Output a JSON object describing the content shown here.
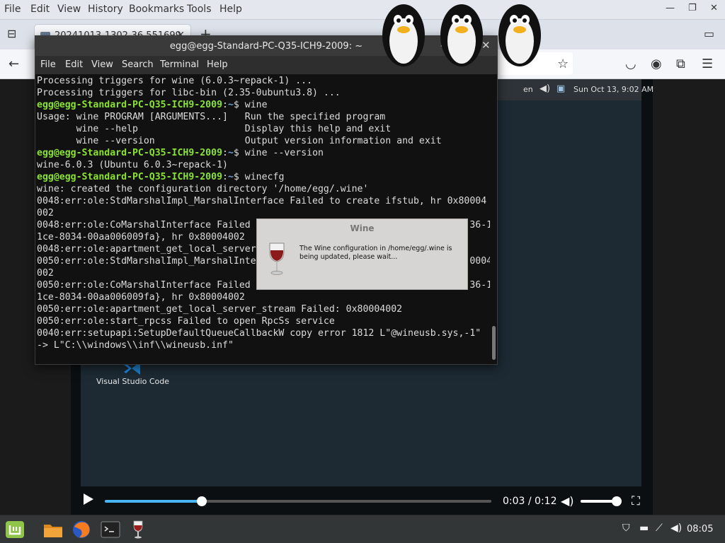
{
  "firefox": {
    "menu": [
      "File",
      "Edit",
      "View",
      "History",
      "Bookmarks",
      "Tools",
      "Help"
    ],
    "tab_title": "20241013-1302-36.551699",
    "new_tab": "+",
    "window_buttons": [
      "—",
      "❐",
      "✕"
    ]
  },
  "vm_panel": {
    "language": "en",
    "datetime": "Sun Oct 13,  9:02 AM"
  },
  "desktop": {
    "icon_label": "Visual Studio Code"
  },
  "terminal": {
    "title": "egg@egg-Standard-PC-Q35-ICH9-2009: ~",
    "menu": [
      "File",
      "Edit",
      "View",
      "Search",
      "Terminal",
      "Help"
    ],
    "lines": [
      {
        "text": "Processing triggers for wine (6.0.3~repack-1) ..."
      },
      {
        "text": "Processing triggers for libc-bin (2.35-0ubuntu3.8) ..."
      },
      {
        "prompt": "egg@egg-Standard-PC-Q35-ICH9-2009",
        "path": "~",
        "cmd": "$ wine"
      },
      {
        "text": "Usage: wine PROGRAM [ARGUMENTS...]   Run the specified program"
      },
      {
        "text": "       wine --help                   Display this help and exit"
      },
      {
        "text": "       wine --version                Output version information and exit"
      },
      {
        "prompt": "egg@egg-Standard-PC-Q35-ICH9-2009",
        "path": "~",
        "cmd": "$ wine --version"
      },
      {
        "text": "wine-6.0.3 (Ubuntu 6.0.3~repack-1)"
      },
      {
        "prompt": "egg@egg-Standard-PC-Q35-ICH9-2009",
        "path": "~",
        "cmd": "$ winecfg"
      },
      {
        "text": "wine: created the configuration directory '/home/egg/.wine'"
      },
      {
        "text": "0048:err:ole:StdMarshalImpl_MarshalInterface Failed to create ifstub, hr 0x80004"
      },
      {
        "text": "002"
      },
      {
        "text": "0048:err:ole:CoMarshalInterface Failed                                       36-1"
      },
      {
        "text": "1ce-8034-00aa006009fa}, hr 0x80004002"
      },
      {
        "text": "0048:err:ole:apartment_get_local_server"
      },
      {
        "text": "0050:err:ole:StdMarshalImpl_MarshalInte                                      0004"
      },
      {
        "text": "002"
      },
      {
        "text": "0050:err:ole:CoMarshalInterface Failed                                       36-1"
      },
      {
        "text": "1ce-8034-00aa006009fa}, hr 0x80004002"
      },
      {
        "text": "0050:err:ole:apartment_get_local_server_stream Failed: 0x80004002"
      },
      {
        "text": "0050:err:ole:start_rpcss Failed to open RpcSs service"
      },
      {
        "text": "0040:err:setupapi:SetupDefaultQueueCallbackW copy error 1812 L\"@wineusb.sys,-1\""
      },
      {
        "text": "-> L\"C:\\\\windows\\\\inf\\\\wineusb.inf\""
      }
    ]
  },
  "wine_dialog": {
    "title": "Wine",
    "message": "The Wine configuration in /home/egg/.wine is being updated, please wait..."
  },
  "player": {
    "time": "0:03 / 0:12",
    "progress": 0.25,
    "volume": 0.95
  },
  "taskbar": {
    "clock": "08:05"
  },
  "colors": {
    "prompt": "#8ae234",
    "path": "#729fcf",
    "seek": "#47b5f6"
  }
}
